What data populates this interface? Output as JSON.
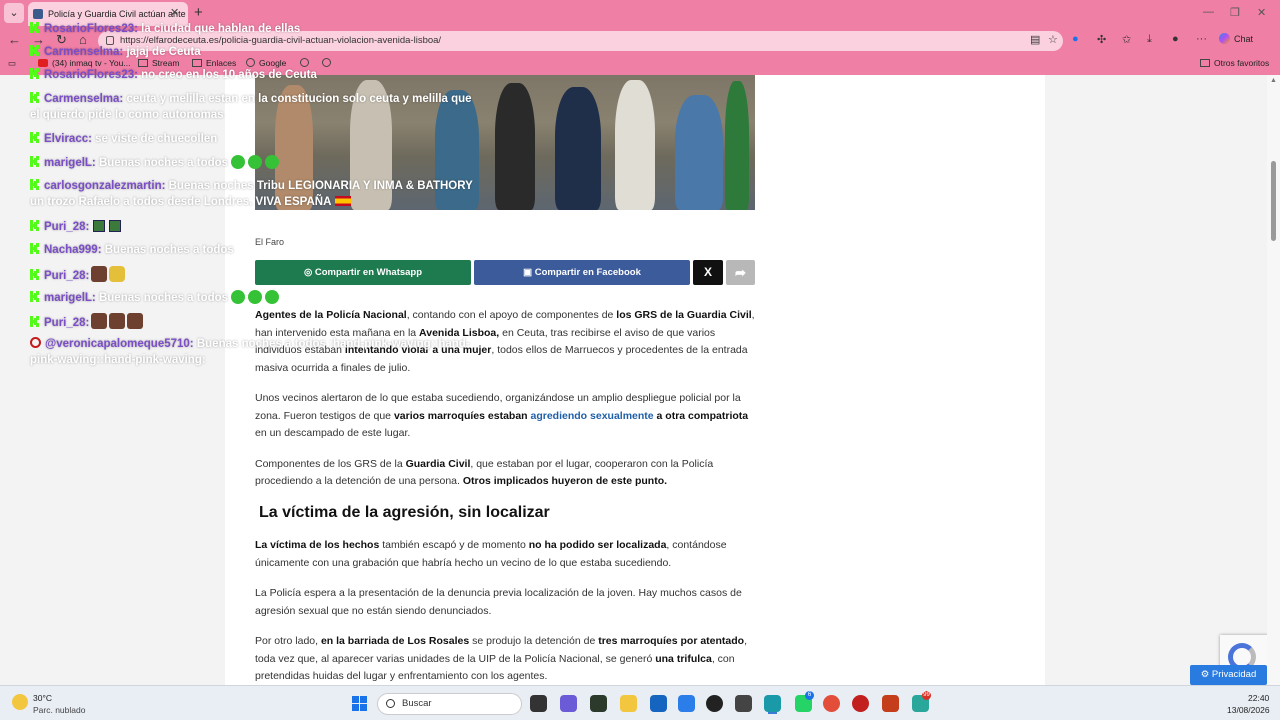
{
  "browser": {
    "tab_title": "Policía y Guardia Civil actúan ante",
    "url": "https://elfarodeceuta.es/policia-guardia-civil-actuan-violacion-avenida-lisboa/",
    "bookmarks": [
      "(34) inmaq tv - You...",
      "Stream",
      "Enlaces",
      "Google"
    ],
    "other_favorites": "Otros favoritos",
    "copilot_label": "Chat"
  },
  "chat": {
    "messages": [
      {
        "user": "RosarioFlores23:",
        "text": "la ciudad que hablan de ellas"
      },
      {
        "user": "Carmenselma:",
        "text": "jajaj de Ceuta"
      },
      {
        "user": "RosarioFlores23:",
        "text": "no creo en los 10 años de Ceuta"
      },
      {
        "user": "Carmenselma:",
        "text": "ceuta y melilla estan en la constitucion solo ceuta y melilla que"
      },
      {
        "user": "",
        "text": "el quierdo pide lo como autonomas"
      },
      {
        "user": "Elviracc:",
        "text": "se viste de chuecollen"
      },
      {
        "user": "marigelL:",
        "text": "Buenas noches a todos"
      },
      {
        "user": "carlosgonzalezmartin:",
        "text": "Buenas noches Tribu LEGIONARIA Y INMA & BATHORY"
      },
      {
        "user": "",
        "text": "un trozo Rafaelo   a todos desde Londres. VIVA ESPAÑA"
      },
      {
        "user": "Puri_28:",
        "text": ""
      },
      {
        "user": "Nacha999:",
        "text": "Buenas noches a todos"
      },
      {
        "user": "Puri_28:",
        "text": ""
      },
      {
        "user": "marigelL:",
        "text": "Buenas noches a todos"
      },
      {
        "user": "Puri_28:",
        "text": ""
      },
      {
        "user": "@veronicapalomeque5710:",
        "text": "Buenas noches a todos :hand-pink-waving::hand-"
      },
      {
        "user": "",
        "text": "pink-waving::hand-pink-waving:"
      }
    ]
  },
  "article": {
    "image_caption": "El Faro",
    "share_whatsapp": "Compartir en Whatsapp",
    "share_facebook": "Compartir en Facebook",
    "share_x": "X",
    "p1": {
      "b1": "Agentes de la Policía Nacional",
      "t1": ", contando con el apoyo de componentes de ",
      "b2": "los GRS de la Guardia Civil",
      "t2": ", han intervenido esta mañana en la ",
      "b3": "Avenida Lisboa,",
      "t3": " en Ceuta, tras recibirse el aviso de que varios individuos estaban ",
      "b4": "intentando violar a una mujer",
      "t4": ", todos ellos de Marruecos y procedentes de la entrada masiva ocurrida a finales de julio."
    },
    "p2": {
      "t1": "Unos vecinos alertaron de lo que estaba sucediendo, organizándose un amplio despliegue policial por la zona. Fueron testigos de que ",
      "b1": "varios marroquíes estaban ",
      "link": "agrediendo sexualmente",
      "b2": " a otra compatriota",
      "t2": " en un descampado de este lugar."
    },
    "p3": {
      "t1": "Componentes de los GRS de la ",
      "b1": "Guardia Civil",
      "t2": ", que estaban por el lugar, cooperaron con la Policía procediendo a la detención de una persona. ",
      "b2": "Otros implicados huyeron de este punto."
    },
    "h2": "La víctima de la agresión, sin localizar",
    "p4": {
      "b1": "La víctima de los hechos",
      "t1": " también escapó y de momento ",
      "b2": "no ha podido ser localizada",
      "t2": ", contándose únicamente con una grabación que habría hecho un vecino de lo que estaba sucediendo."
    },
    "p5": "La Policía espera a la presentación de la denuncia previa localización de la joven. Hay muchos casos de agresión sexual que no están siendo denunciados.",
    "p6": {
      "t1": "Por otro lado, ",
      "b1": "en la barriada de Los Rosales",
      "t2": " se produjo la detención de ",
      "b2": "tres marroquíes por atentado",
      "t3": ", toda vez que, al aparecer varias unidades de la UIP de la Policía Nacional, se generó ",
      "b3": "una trifulca",
      "t4": ", con pretendidas huidas del lugar y enfrentamiento con los agentes."
    }
  },
  "privacy_label": "Privacidad",
  "taskbar": {
    "weather_temp": "30°C",
    "weather_desc": "Parc. nublado",
    "search_placeholder": "Buscar",
    "time": "22:40",
    "date": "13/08/2026",
    "badges": [
      "6",
      "99"
    ]
  },
  "colors": {
    "browser_chrome": "#f07fa6",
    "whatsapp_green": "#1e7a4f",
    "facebook_blue": "#3c5b9a",
    "chat_username": "#7b4ec7",
    "privacy_button": "#2a7be0"
  }
}
